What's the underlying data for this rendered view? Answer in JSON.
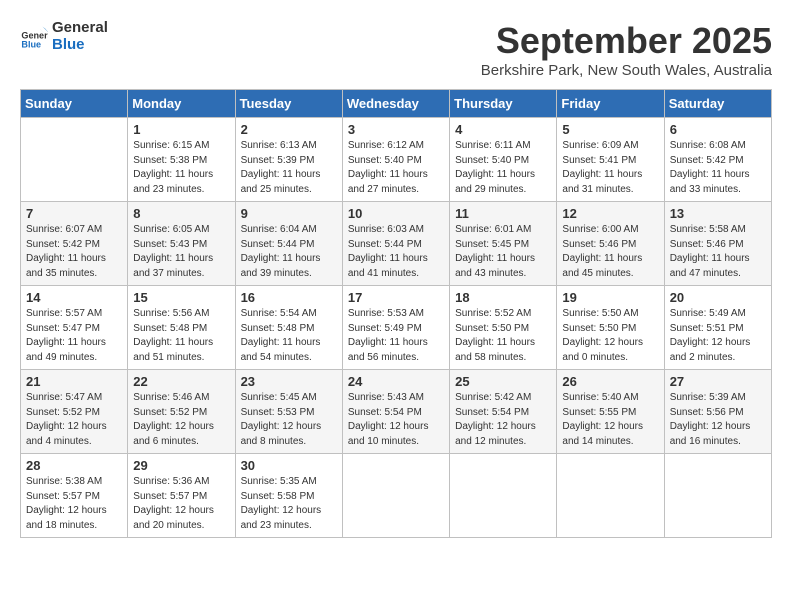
{
  "header": {
    "logo_line1": "General",
    "logo_line2": "Blue",
    "month": "September 2025",
    "location": "Berkshire Park, New South Wales, Australia"
  },
  "columns": [
    "Sunday",
    "Monday",
    "Tuesday",
    "Wednesday",
    "Thursday",
    "Friday",
    "Saturday"
  ],
  "weeks": [
    [
      {
        "day": "",
        "info": ""
      },
      {
        "day": "1",
        "info": "Sunrise: 6:15 AM\nSunset: 5:38 PM\nDaylight: 11 hours\nand 23 minutes."
      },
      {
        "day": "2",
        "info": "Sunrise: 6:13 AM\nSunset: 5:39 PM\nDaylight: 11 hours\nand 25 minutes."
      },
      {
        "day": "3",
        "info": "Sunrise: 6:12 AM\nSunset: 5:40 PM\nDaylight: 11 hours\nand 27 minutes."
      },
      {
        "day": "4",
        "info": "Sunrise: 6:11 AM\nSunset: 5:40 PM\nDaylight: 11 hours\nand 29 minutes."
      },
      {
        "day": "5",
        "info": "Sunrise: 6:09 AM\nSunset: 5:41 PM\nDaylight: 11 hours\nand 31 minutes."
      },
      {
        "day": "6",
        "info": "Sunrise: 6:08 AM\nSunset: 5:42 PM\nDaylight: 11 hours\nand 33 minutes."
      }
    ],
    [
      {
        "day": "7",
        "info": "Sunrise: 6:07 AM\nSunset: 5:42 PM\nDaylight: 11 hours\nand 35 minutes."
      },
      {
        "day": "8",
        "info": "Sunrise: 6:05 AM\nSunset: 5:43 PM\nDaylight: 11 hours\nand 37 minutes."
      },
      {
        "day": "9",
        "info": "Sunrise: 6:04 AM\nSunset: 5:44 PM\nDaylight: 11 hours\nand 39 minutes."
      },
      {
        "day": "10",
        "info": "Sunrise: 6:03 AM\nSunset: 5:44 PM\nDaylight: 11 hours\nand 41 minutes."
      },
      {
        "day": "11",
        "info": "Sunrise: 6:01 AM\nSunset: 5:45 PM\nDaylight: 11 hours\nand 43 minutes."
      },
      {
        "day": "12",
        "info": "Sunrise: 6:00 AM\nSunset: 5:46 PM\nDaylight: 11 hours\nand 45 minutes."
      },
      {
        "day": "13",
        "info": "Sunrise: 5:58 AM\nSunset: 5:46 PM\nDaylight: 11 hours\nand 47 minutes."
      }
    ],
    [
      {
        "day": "14",
        "info": "Sunrise: 5:57 AM\nSunset: 5:47 PM\nDaylight: 11 hours\nand 49 minutes."
      },
      {
        "day": "15",
        "info": "Sunrise: 5:56 AM\nSunset: 5:48 PM\nDaylight: 11 hours\nand 51 minutes."
      },
      {
        "day": "16",
        "info": "Sunrise: 5:54 AM\nSunset: 5:48 PM\nDaylight: 11 hours\nand 54 minutes."
      },
      {
        "day": "17",
        "info": "Sunrise: 5:53 AM\nSunset: 5:49 PM\nDaylight: 11 hours\nand 56 minutes."
      },
      {
        "day": "18",
        "info": "Sunrise: 5:52 AM\nSunset: 5:50 PM\nDaylight: 11 hours\nand 58 minutes."
      },
      {
        "day": "19",
        "info": "Sunrise: 5:50 AM\nSunset: 5:50 PM\nDaylight: 12 hours\nand 0 minutes."
      },
      {
        "day": "20",
        "info": "Sunrise: 5:49 AM\nSunset: 5:51 PM\nDaylight: 12 hours\nand 2 minutes."
      }
    ],
    [
      {
        "day": "21",
        "info": "Sunrise: 5:47 AM\nSunset: 5:52 PM\nDaylight: 12 hours\nand 4 minutes."
      },
      {
        "day": "22",
        "info": "Sunrise: 5:46 AM\nSunset: 5:52 PM\nDaylight: 12 hours\nand 6 minutes."
      },
      {
        "day": "23",
        "info": "Sunrise: 5:45 AM\nSunset: 5:53 PM\nDaylight: 12 hours\nand 8 minutes."
      },
      {
        "day": "24",
        "info": "Sunrise: 5:43 AM\nSunset: 5:54 PM\nDaylight: 12 hours\nand 10 minutes."
      },
      {
        "day": "25",
        "info": "Sunrise: 5:42 AM\nSunset: 5:54 PM\nDaylight: 12 hours\nand 12 minutes."
      },
      {
        "day": "26",
        "info": "Sunrise: 5:40 AM\nSunset: 5:55 PM\nDaylight: 12 hours\nand 14 minutes."
      },
      {
        "day": "27",
        "info": "Sunrise: 5:39 AM\nSunset: 5:56 PM\nDaylight: 12 hours\nand 16 minutes."
      }
    ],
    [
      {
        "day": "28",
        "info": "Sunrise: 5:38 AM\nSunset: 5:57 PM\nDaylight: 12 hours\nand 18 minutes."
      },
      {
        "day": "29",
        "info": "Sunrise: 5:36 AM\nSunset: 5:57 PM\nDaylight: 12 hours\nand 20 minutes."
      },
      {
        "day": "30",
        "info": "Sunrise: 5:35 AM\nSunset: 5:58 PM\nDaylight: 12 hours\nand 23 minutes."
      },
      {
        "day": "",
        "info": ""
      },
      {
        "day": "",
        "info": ""
      },
      {
        "day": "",
        "info": ""
      },
      {
        "day": "",
        "info": ""
      }
    ]
  ]
}
